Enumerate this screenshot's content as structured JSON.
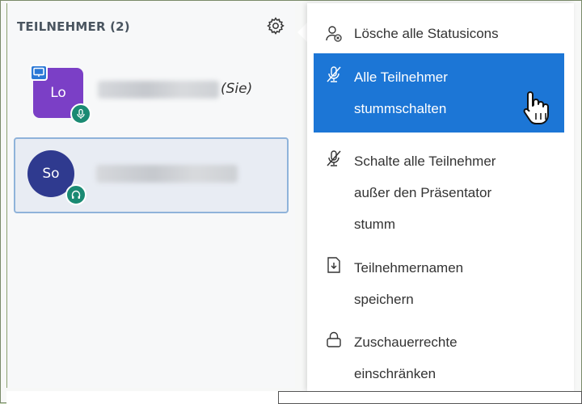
{
  "panel": {
    "title": "TEILNEHMER (2)",
    "users": [
      {
        "initials": "Lo",
        "you_label": "(Sie)",
        "avatar_color": "#7b3fc6",
        "status_icon": "microphone-icon",
        "presenter": true
      },
      {
        "initials": "So",
        "avatar_color": "#2f3a8f",
        "status_icon": "headphones-icon",
        "presenter": false
      }
    ]
  },
  "menu": {
    "items": [
      {
        "label": "Lösche alle Statusicons",
        "icon": "clear-status-icon"
      },
      {
        "label_line1": "Alle Teilnehmer",
        "label_line2": "stummschalten",
        "icon": "mute-mic-icon",
        "highlighted": true
      },
      {
        "label_line1": "Schalte alle Teilnehmer",
        "label_line2": "außer den Präsentator",
        "label_line3": "stumm",
        "icon": "mute-mic-icon"
      },
      {
        "label_line1": "Teilnehmernamen",
        "label_line2": "speichern",
        "icon": "download-file-icon"
      },
      {
        "label_line1": "Zuschauerrechte",
        "label_line2": "einschränken",
        "icon": "lock-icon"
      }
    ]
  },
  "colors": {
    "highlight": "#1c76d6",
    "status_badge": "#1a8a73",
    "presenter_badge": "#2b79d6"
  }
}
